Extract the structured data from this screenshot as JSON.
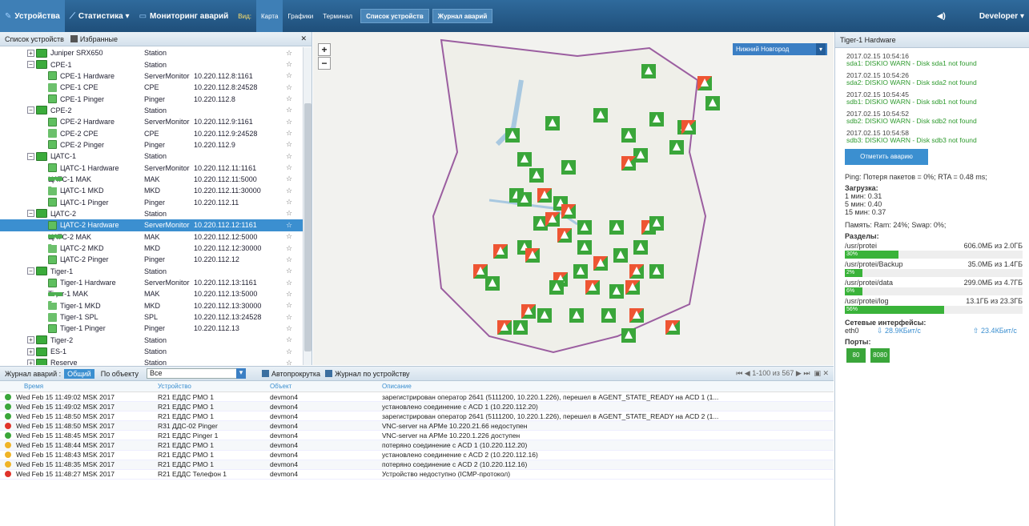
{
  "topbar": {
    "devices": "Устройства",
    "stats": "Статистика",
    "monitor": "Мониторинг аварий",
    "view": "Вид:",
    "map": "Карта",
    "graphs": "Графики",
    "terminal": "Терминал",
    "dev_list": "Список устройств",
    "alarm_log": "Журнал аварий",
    "user": "Developer"
  },
  "left": {
    "title": "Список устройств",
    "fav": "Избранные"
  },
  "tree": [
    {
      "n": "Juniper SRX650",
      "t": "Station",
      "a": "",
      "i": "st",
      "lv": 1,
      "ex": "+"
    },
    {
      "n": "CPE-1",
      "t": "Station",
      "a": "",
      "i": "st",
      "lv": 1,
      "ex": "−"
    },
    {
      "n": "CPE-1 Hardware",
      "t": "ServerMonitor",
      "a": "10.220.112.8:1161",
      "i": "hw",
      "lv": 2
    },
    {
      "n": "CPE-1 CPE",
      "t": "CPE",
      "a": "10.220.112.8:24528",
      "i": "cp",
      "lv": 2
    },
    {
      "n": "CPE-1 Pinger",
      "t": "Pinger",
      "a": "10.220.112.8",
      "i": "hw",
      "lv": 2
    },
    {
      "n": "CPE-2",
      "t": "Station",
      "a": "",
      "i": "st",
      "lv": 1,
      "ex": "−"
    },
    {
      "n": "CPE-2 Hardware",
      "t": "ServerMonitor",
      "a": "10.220.112.9:1161",
      "i": "hw",
      "lv": 2
    },
    {
      "n": "CPE-2 CPE",
      "t": "CPE",
      "a": "10.220.112.9:24528",
      "i": "cp",
      "lv": 2
    },
    {
      "n": "CPE-2 Pinger",
      "t": "Pinger",
      "a": "10.220.112.9",
      "i": "hw",
      "lv": 2
    },
    {
      "n": "ЦАТС-1",
      "t": "Station",
      "a": "",
      "i": "st",
      "lv": 1,
      "ex": "−"
    },
    {
      "n": "ЦАТС-1 Hardware",
      "t": "ServerMonitor",
      "a": "10.220.112.11:1161",
      "i": "hw",
      "lv": 2
    },
    {
      "n": "ЦАТС-1 MAK",
      "t": "MAK",
      "a": "10.220.112.11:5000",
      "i": "mk",
      "lv": 2
    },
    {
      "n": "ЦАТС-1 MKD",
      "t": "MKD",
      "a": "10.220.112.11:30000",
      "i": "cp",
      "lv": 2
    },
    {
      "n": "ЦАТС-1 Pinger",
      "t": "Pinger",
      "a": "10.220.112.11",
      "i": "hw",
      "lv": 2
    },
    {
      "n": "ЦАТС-2",
      "t": "Station",
      "a": "",
      "i": "st",
      "lv": 1,
      "ex": "−"
    },
    {
      "n": "ЦАТС-2 Hardware",
      "t": "ServerMonitor",
      "a": "10.220.112.12:1161",
      "i": "hw",
      "lv": 2,
      "sel": true
    },
    {
      "n": "ЦАТС-2 MAK",
      "t": "MAK",
      "a": "10.220.112.12:5000",
      "i": "mk",
      "lv": 2
    },
    {
      "n": "ЦАТС-2 MKD",
      "t": "MKD",
      "a": "10.220.112.12:30000",
      "i": "cp",
      "lv": 2
    },
    {
      "n": "ЦАТС-2 Pinger",
      "t": "Pinger",
      "a": "10.220.112.12",
      "i": "hw",
      "lv": 2
    },
    {
      "n": "Tiger-1",
      "t": "Station",
      "a": "",
      "i": "st",
      "lv": 1,
      "ex": "−"
    },
    {
      "n": "Tiger-1 Hardware",
      "t": "ServerMonitor",
      "a": "10.220.112.13:1161",
      "i": "hw",
      "lv": 2
    },
    {
      "n": "Tiger-1 MAK",
      "t": "MAK",
      "a": "10.220.112.13:5000",
      "i": "mk",
      "lv": 2
    },
    {
      "n": "Tiger-1 MKD",
      "t": "MKD",
      "a": "10.220.112.13:30000",
      "i": "cp",
      "lv": 2
    },
    {
      "n": "Tiger-1 SPL",
      "t": "SPL",
      "a": "10.220.112.13:24528",
      "i": "cp",
      "lv": 2
    },
    {
      "n": "Tiger-1 Pinger",
      "t": "Pinger",
      "a": "10.220.112.13",
      "i": "hw",
      "lv": 2
    },
    {
      "n": "Tiger-2",
      "t": "Station",
      "a": "",
      "i": "st",
      "lv": 1,
      "ex": "+"
    },
    {
      "n": "ES-1",
      "t": "Station",
      "a": "",
      "i": "st",
      "lv": 1,
      "ex": "+"
    },
    {
      "n": "Reserve",
      "t": "Station",
      "a": "",
      "i": "st",
      "lv": 1,
      "ex": "+"
    }
  ],
  "map": {
    "region": "Нижний Новгород"
  },
  "right": {
    "title": "Tiger-1 Hardware",
    "logs": [
      {
        "ts": "2017.02.15 10:54:16",
        "msg": "sda1: DISKIO WARN - Disk sda1 not found"
      },
      {
        "ts": "2017.02.15 10:54:26",
        "msg": "sda2: DISKIO WARN - Disk sda2 not found"
      },
      {
        "ts": "2017.02.15 10:54:45",
        "msg": "sdb1: DISKIO WARN - Disk sdb1 not found"
      },
      {
        "ts": "2017.02.15 10:54:52",
        "msg": "sdb2: DISKIO WARN - Disk sdb2 not found"
      },
      {
        "ts": "2017.02.15 10:54:58",
        "msg": "sdb3: DISKIO WARN - Disk sdb3 not found"
      }
    ],
    "ack": "Отметить аварию",
    "ping": "Ping: Потеря пакетов = 0%; RTA = 0.48 ms;",
    "load_title": "Загрузка:",
    "load1": "1 мин: 0.31",
    "load5": "5 мин: 0.40",
    "load15": "15 мин: 0.37",
    "mem": "Память: Ram: 24%; Swap: 0%;",
    "parts_title": "Разделы:",
    "parts": [
      {
        "p": "/usr/protei",
        "s": "606.0МБ из 2.0ГБ",
        "v": "30%",
        "f": 0.3
      },
      {
        "p": "/usr/protei/Backup",
        "s": "35.0МБ из 1.4ГБ",
        "v": "2%",
        "f": 0.02
      },
      {
        "p": "/usr/protei/data",
        "s": "299.0МБ из 4.7ГБ",
        "v": "6%",
        "f": 0.06
      },
      {
        "p": "/usr/protei/log",
        "s": "13.1ГБ из 23.3ГБ",
        "v": "56%",
        "f": 0.56
      }
    ],
    "net_title": "Сетевые интерфейсы:",
    "iface": "eth0",
    "rx": "28.9КБит/с",
    "tx": "23.4КБит/с",
    "ports_title": "Порты:",
    "ports": [
      "80",
      "8080"
    ]
  },
  "bottom": {
    "title": "Журнал аварий :",
    "tab_all": "Общий",
    "tab_obj": "По объекту",
    "filter": "Все",
    "autoscroll": "Автопрокрутка",
    "by_dev": "Журнал по устройству",
    "pager": "1-100 из 567",
    "cols": [
      "Время",
      "Устройство",
      "Объект",
      "Описание"
    ],
    "events": [
      {
        "s": "ok",
        "t": "Wed Feb 15 11:49:02 MSK 2017",
        "d": "R21 ЕДДС РМО 1",
        "o": "devmon4",
        "m": "зарегистрирован оператор 2641 (5111200, 10.220.1.226), перешел в AGENT_STATE_READY на ACD 1 (1..."
      },
      {
        "s": "ok",
        "t": "Wed Feb 15 11:49:02 MSK 2017",
        "d": "R21 ЕДДС РМО 1",
        "o": "devmon4",
        "m": "установлено соединение с ACD 1 (10.220.112.20)"
      },
      {
        "s": "ok",
        "t": "Wed Feb 15 11:48:50 MSK 2017",
        "d": "R21 ЕДДС РМО 1",
        "o": "devmon4",
        "m": "зарегистрирован оператор 2641 (5111200, 10.220.1.226), перешел в AGENT_STATE_READY на ACD 2 (1..."
      },
      {
        "s": "err",
        "t": "Wed Feb 15 11:48:50 MSK 2017",
        "d": "R31 ДДС-02 Pinger",
        "o": "devmon4",
        "m": "VNC-server на АРМе 10.220.21.66 недоступен"
      },
      {
        "s": "ok",
        "t": "Wed Feb 15 11:48:45 MSK 2017",
        "d": "R21 ЕДДС Pinger 1",
        "o": "devmon4",
        "m": "VNC-server на АРМе 10.220.1.226 доступен"
      },
      {
        "s": "warn",
        "t": "Wed Feb 15 11:48:44 MSK 2017",
        "d": "R21 ЕДДС РМО 1",
        "o": "devmon4",
        "m": "потеряно соединение с ACD 1 (10.220.112.20)"
      },
      {
        "s": "warn",
        "t": "Wed Feb 15 11:48:43 MSK 2017",
        "d": "R21 ЕДДС РМО 1",
        "o": "devmon4",
        "m": "установлено соединение с ACD 2 (10.220.112.16)"
      },
      {
        "s": "warn",
        "t": "Wed Feb 15 11:48:35 MSK 2017",
        "d": "R21 ЕДДС РМО 1",
        "o": "devmon4",
        "m": "потеряно соединение с ACD 2 (10.220.112.16)"
      },
      {
        "s": "err",
        "t": "Wed Feb 15 11:48:27 MSK 2017",
        "d": "R21 ЕДДС Телефон 1",
        "o": "devmon4",
        "m": "Устройство недоступно (ICMP-протокол)"
      }
    ]
  }
}
